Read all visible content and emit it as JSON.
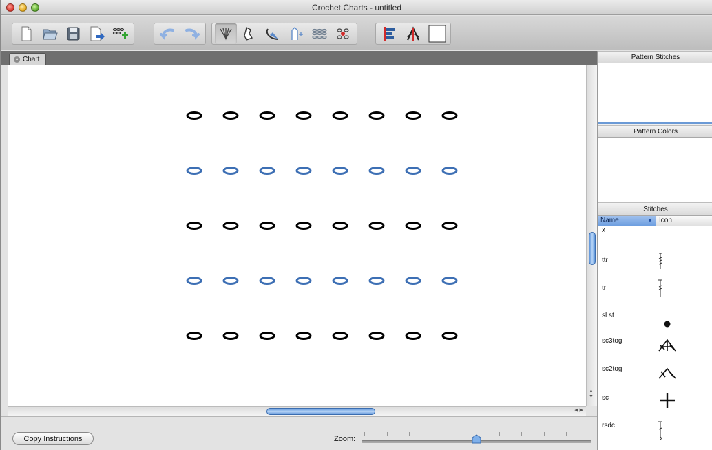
{
  "window": {
    "title": "Crochet Charts - untitled"
  },
  "toolbar": {
    "buttons": [
      {
        "icon": "new-document-icon"
      },
      {
        "icon": "open-icon"
      },
      {
        "icon": "save-icon"
      },
      {
        "icon": "export-icon"
      },
      {
        "icon": "add-rows-icon"
      },
      {
        "icon": "undo-icon"
      },
      {
        "icon": "redo-icon"
      },
      {
        "icon": "stitch-mode-icon",
        "active": true
      },
      {
        "icon": "color-mode-icon"
      },
      {
        "icon": "angle-mode-icon"
      },
      {
        "icon": "stretch-mode-icon"
      },
      {
        "icon": "create-rows-icon"
      },
      {
        "icon": "indicator-mode-icon"
      },
      {
        "icon": "align-icon"
      },
      {
        "icon": "center-icon"
      },
      {
        "icon": "color-swatch-icon"
      }
    ]
  },
  "tabs": [
    {
      "label": "Chart"
    }
  ],
  "chart": {
    "rows": 5,
    "stitches_per_row": 8,
    "row_colors": [
      "#000000",
      "#3d6fb4",
      "#000000",
      "#3d6fb4",
      "#000000"
    ]
  },
  "bottom": {
    "copy_button": "Copy Instructions",
    "zoom_label": "Zoom:",
    "zoom_value": 0.5
  },
  "panels": {
    "pattern_stitches": "Pattern Stitches",
    "pattern_colors": "Pattern Colors",
    "stitches": "Stitches",
    "columns": {
      "name": "Name",
      "icon": "Icon"
    },
    "stitch_list": [
      {
        "name": "x",
        "icon": "none"
      },
      {
        "name": "ttr",
        "icon": "ttr-icon"
      },
      {
        "name": "tr",
        "icon": "tr-icon"
      },
      {
        "name": "sl st",
        "icon": "slip-stitch-icon"
      },
      {
        "name": "sc3tog",
        "icon": "sc3tog-icon"
      },
      {
        "name": "sc2tog",
        "icon": "sc2tog-icon"
      },
      {
        "name": "sc",
        "icon": "single-crochet-icon"
      },
      {
        "name": "rsdc",
        "icon": "rsdc-icon"
      }
    ]
  },
  "colors": {
    "accent": "#6b9ad6",
    "chain_blue": "#3d6fb4"
  }
}
